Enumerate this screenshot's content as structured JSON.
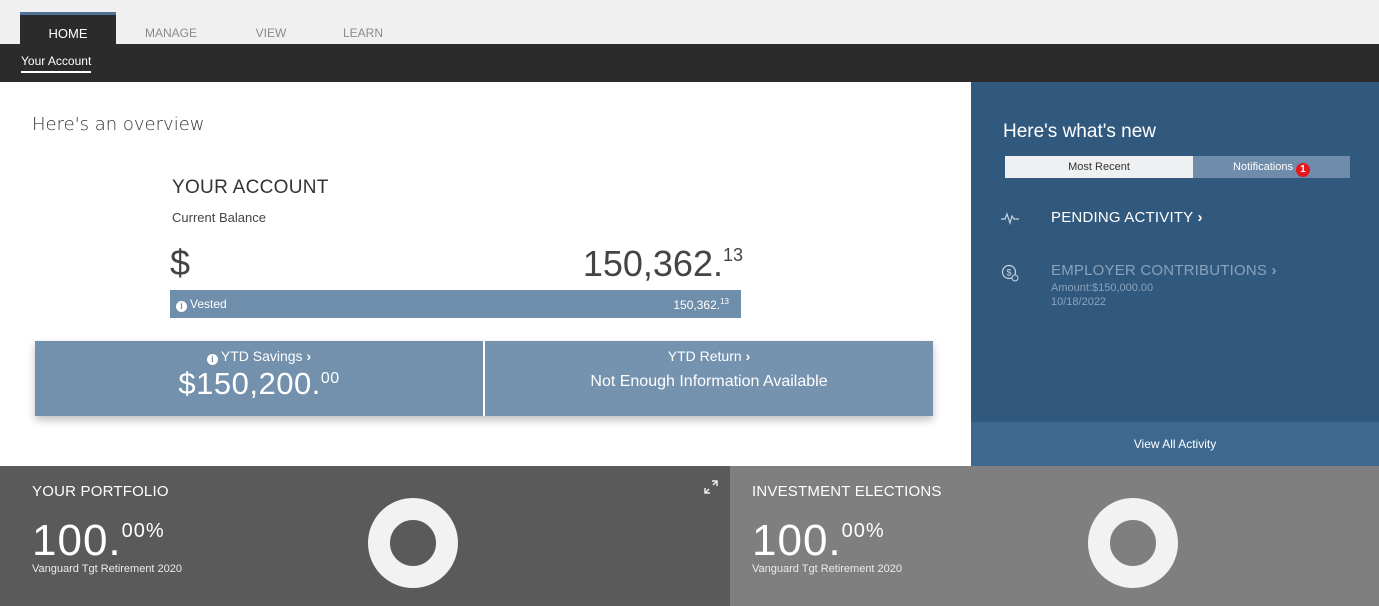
{
  "nav": {
    "tabs": [
      {
        "label": "HOME"
      },
      {
        "label": "MANAGE"
      },
      {
        "label": "VIEW"
      },
      {
        "label": "LEARN"
      }
    ],
    "sub_label": "Your Account"
  },
  "overview": {
    "title": "Here's an overview",
    "account_title": "YOUR ACCOUNT",
    "account_sub": "Current Balance",
    "currency_symbol": "$",
    "balance_main": "150,362.",
    "balance_cents": "13",
    "vested_label": "Vested",
    "vested_main": "150,362.",
    "vested_cents": "13",
    "ytd_savings_label": "YTD Savings",
    "ytd_savings_main": "$150,200.",
    "ytd_savings_cents": "00",
    "ytd_return_label": "YTD Return",
    "ytd_return_value": "Not Enough Information Available"
  },
  "whats_new": {
    "title": "Here's what's new",
    "tab_recent": "Most Recent",
    "tab_notifications": "Notifications",
    "notification_count": "1",
    "pending_label": "PENDING ACTIVITY",
    "employer_label": "EMPLOYER CONTRIBUTIONS",
    "employer_amount": "Amount:$150,000.00",
    "employer_date": "10/18/2022",
    "view_all": "View All Activity"
  },
  "portfolio": {
    "title": "YOUR PORTFOLIO",
    "pct_main": "100.",
    "pct_dec": "00%",
    "fund": "Vanguard Tgt Retirement 2020"
  },
  "elections": {
    "title": "INVESTMENT ELECTIONS",
    "pct_main": "100.",
    "pct_dec": "00%",
    "fund": "Vanguard Tgt Retirement 2020"
  },
  "icons": {
    "chevron": "chevron-right-icon",
    "pending": "pulse-icon",
    "employer": "dollar-coin-icon",
    "expand": "expand-icon",
    "info": "info-icon"
  },
  "colors": {
    "nav_dark": "#2b2b2b",
    "panel_blue": "#31597e",
    "vested_blue": "#6f8eab",
    "ytd_blue": "#7391ad",
    "badge_red": "#e8161f",
    "portfolio_gray": "#5a5a5a",
    "elections_gray": "#7f7f7f"
  }
}
